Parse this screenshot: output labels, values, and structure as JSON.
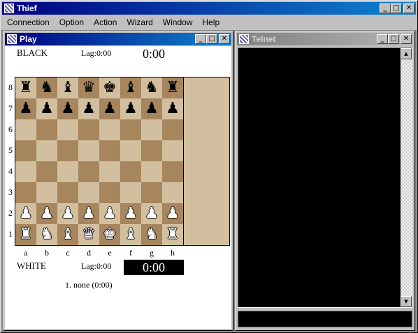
{
  "app": {
    "title": "Thief",
    "controls": {
      "minimize": "_",
      "maximize": "□",
      "close": "✕"
    }
  },
  "menu": [
    "Connection",
    "Option",
    "Action",
    "Wizard",
    "Window",
    "Help"
  ],
  "play_window": {
    "title": "Play",
    "top_player": {
      "name": "BLACK",
      "lag": "Lag:0:00",
      "clock": "0:00"
    },
    "bottom_player": {
      "name": "WHITE",
      "lag": "Lag:0:00",
      "clock": "0:00"
    },
    "move_list": "1. none (0:00)",
    "ranks": [
      "8",
      "7",
      "6",
      "5",
      "4",
      "3",
      "2",
      "1"
    ],
    "files": [
      "a",
      "b",
      "c",
      "d",
      "e",
      "f",
      "g",
      "h"
    ],
    "board": [
      [
        "♜",
        "♞",
        "♝",
        "♛",
        "♚",
        "♝",
        "♞",
        "♜"
      ],
      [
        "♟",
        "♟",
        "♟",
        "♟",
        "♟",
        "♟",
        "♟",
        "♟"
      ],
      [
        "",
        "",
        "",
        "",
        "",
        "",
        "",
        ""
      ],
      [
        "",
        "",
        "",
        "",
        "",
        "",
        "",
        ""
      ],
      [
        "",
        "",
        "",
        "",
        "",
        "",
        "",
        ""
      ],
      [
        "",
        "",
        "",
        "",
        "",
        "",
        "",
        ""
      ],
      [
        "♟",
        "♟",
        "♟",
        "♟",
        "♟",
        "♟",
        "♟",
        "♟"
      ],
      [
        "♜",
        "♞",
        "♝",
        "♛",
        "♚",
        "♝",
        "♞",
        "♜"
      ]
    ],
    "piece_colors": [
      "black",
      "black",
      "",
      "",
      "",
      "",
      "white",
      "white"
    ],
    "square_colors": {
      "light": "#d2bf9f",
      "dark": "#a7865e"
    }
  },
  "telnet_window": {
    "title": "Telnet",
    "scroll_up": "▲",
    "scroll_down": "▼"
  },
  "colors": {
    "active_title": "#000080",
    "inactive_title": "#808080",
    "desktop": "#808080"
  }
}
